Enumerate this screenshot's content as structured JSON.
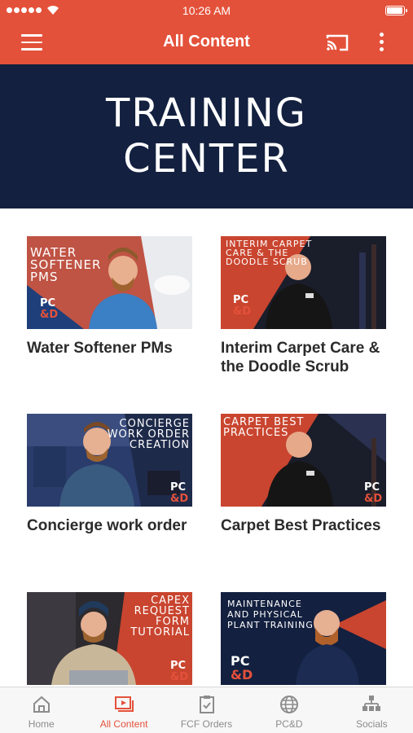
{
  "status": {
    "time": "10:26 AM"
  },
  "appbar": {
    "title": "All Content",
    "menu_icon": "hamburger-icon",
    "cast_icon": "cast-icon",
    "more_icon": "more-vert-icon"
  },
  "banner": {
    "line1": "TRAINING",
    "line2": "CENTER"
  },
  "cards": [
    {
      "title": "Water Softener PMs",
      "thumb_text": "WATER SOFTENER PMs",
      "pcd": "PC",
      "amp": "&D"
    },
    {
      "title": "Interim Carpet Care & the Doodle Scrub",
      "thumb_text": "INTERIM CARPET CARE & THE DOODLE SCRUB",
      "pcd": "PC",
      "amp": "&D"
    },
    {
      "title": "Concierge work order",
      "thumb_text": "CONCIERGE WORK ORDER CREATION",
      "pcd": "PC",
      "amp": "&D"
    },
    {
      "title": "Carpet Best Practices",
      "thumb_text": "CARPET BEST PRACTICES",
      "pcd": "PC",
      "amp": "&D"
    },
    {
      "title": "",
      "thumb_text": "CAPEX REQUEST FORM TUTORIAL",
      "pcd": "PC",
      "amp": "&D"
    },
    {
      "title": "",
      "thumb_text": "MAINTENANCE AND PHYSICAL PLANT TRAINING",
      "pcd": "PC",
      "amp": "&D"
    }
  ],
  "nav": [
    {
      "label": "Home",
      "icon": "home-icon",
      "active": false
    },
    {
      "label": "All Content",
      "icon": "video-library-icon",
      "active": true
    },
    {
      "label": "FCF Orders",
      "icon": "clipboard-check-icon",
      "active": false
    },
    {
      "label": "PC&D",
      "icon": "globe-icon",
      "active": false
    },
    {
      "label": "Socials",
      "icon": "people-network-icon",
      "active": false
    }
  ],
  "colors": {
    "brand": "#e4513a",
    "banner_bg": "#13203f"
  }
}
